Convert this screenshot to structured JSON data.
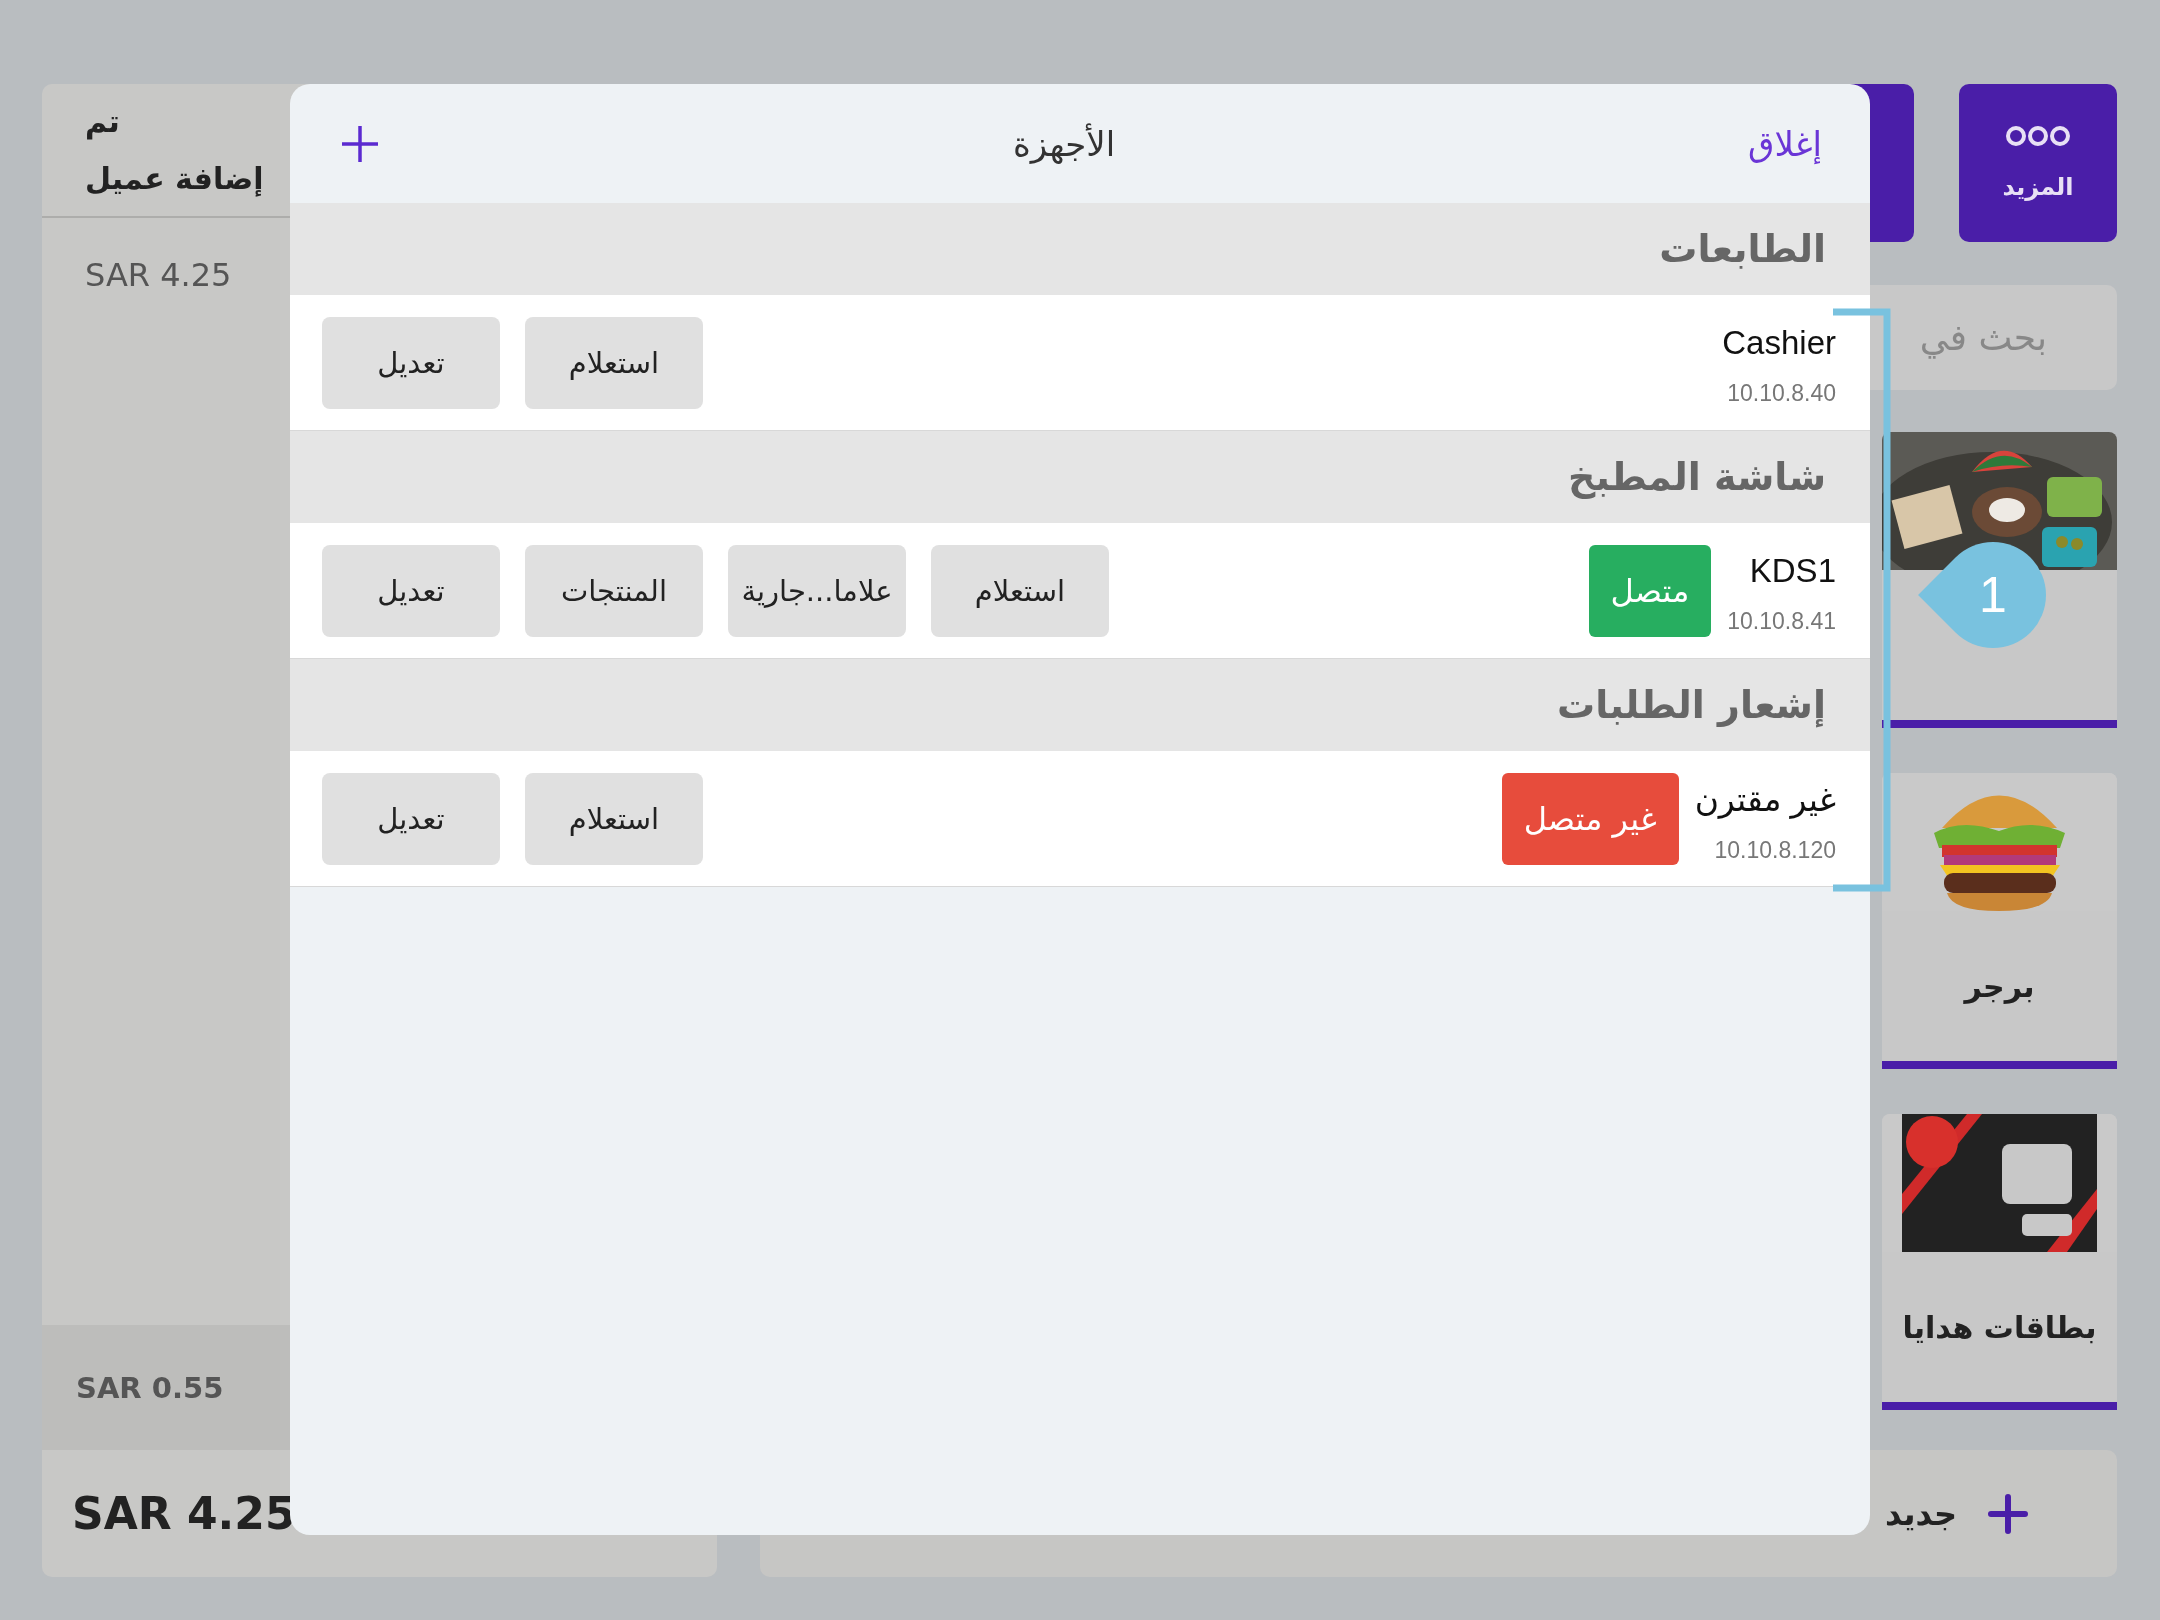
{
  "side_panel": {
    "done": "تم",
    "add_customer": "إضافة عميل",
    "subtotal": "SAR 4.25",
    "tax": "SAR 0.55",
    "total": "SAR 4.25"
  },
  "toolbar": {
    "more": "المزيد"
  },
  "search": {
    "placeholder": "بحث في"
  },
  "categories": [
    {
      "kind": "food_platter"
    },
    {
      "kind": "burger",
      "label": "برجر"
    },
    {
      "kind": "gift_card",
      "label": "بطاقات هدايا"
    }
  ],
  "bottom_bar": {
    "new": "جديد"
  },
  "modal": {
    "title": "الأجهزة",
    "close": "إغلاق",
    "sections": [
      {
        "title": "الطابعات",
        "devices": [
          {
            "name": "Cashier",
            "ip": "10.10.8.40",
            "buttons": [
              "استعلام",
              "تعديل"
            ]
          }
        ]
      },
      {
        "title": "شاشة المطبخ",
        "devices": [
          {
            "name": "KDS1",
            "ip": "10.10.8.41",
            "status": {
              "label": "متصل",
              "kind": "connected"
            },
            "buttons": [
              "استعلام",
              "علاما...جارية",
              "المنتجات",
              "تعديل"
            ]
          }
        ]
      },
      {
        "title": "إشعار الطلبات",
        "devices": [
          {
            "name": "غير مقترن",
            "ip": "10.10.8.120",
            "status": {
              "label": "غير متصل",
              "kind": "disconnected"
            },
            "buttons": [
              "استعلام",
              "تعديل"
            ]
          }
        ]
      }
    ]
  },
  "callout": {
    "label": "1"
  }
}
